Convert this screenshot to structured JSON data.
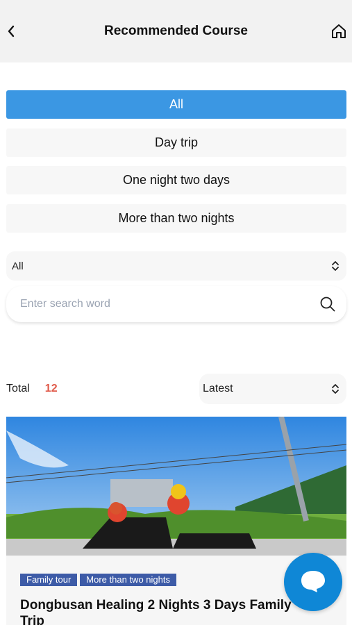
{
  "header": {
    "title": "Recommended Course",
    "back_icon": "chevron-left-icon",
    "home_icon": "home-icon"
  },
  "filters": [
    {
      "label": "All",
      "active": true
    },
    {
      "label": "Day trip",
      "active": false
    },
    {
      "label": "One night two days",
      "active": false
    },
    {
      "label": "More than two nights",
      "active": false
    }
  ],
  "category_select": {
    "value": "All"
  },
  "search": {
    "placeholder": "Enter search word",
    "value": ""
  },
  "results": {
    "total_label": "Total",
    "total_count": "12",
    "sort_value": "Latest"
  },
  "card": {
    "tags": [
      "Family tour",
      "More than two nights"
    ],
    "title": "Dongbusan Healing 2 Nights 3 Days Family Trip"
  },
  "colors": {
    "accent": "#3b97e3",
    "count": "#e05a4a",
    "tag": "#3d5ba7",
    "fab": "#0f87d6"
  }
}
